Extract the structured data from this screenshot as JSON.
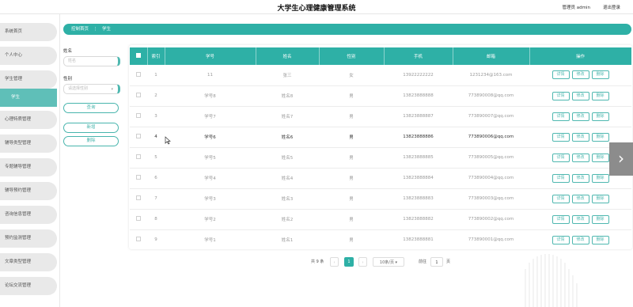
{
  "header": {
    "title": "大学生心理健康管理系统",
    "user": "管理员 admin",
    "logout": "退出登录"
  },
  "sidebar": {
    "items": [
      {
        "label": "系统首页"
      },
      {
        "label": "个人中心"
      },
      {
        "label": "学生管理"
      },
      {
        "label": "学生"
      },
      {
        "label": "心理特质管理"
      },
      {
        "label": "辅导类型管理"
      },
      {
        "label": "专题辅导管理"
      },
      {
        "label": "辅导预约管理"
      },
      {
        "label": "咨询信息管理"
      },
      {
        "label": "预约监测管理"
      },
      {
        "label": "文章类型管理"
      },
      {
        "label": "论坛交流管理"
      }
    ]
  },
  "breadcrumb": {
    "home": "控制首页",
    "sep": "⋮",
    "current": "学生"
  },
  "filter": {
    "name_label": "姓名",
    "name_placeholder": "姓名",
    "gender_label": "性别",
    "gender_placeholder": "请选择性别",
    "search_btn": "查询",
    "add_btn": "新增",
    "delete_btn": "删除"
  },
  "table": {
    "headers": [
      "索引",
      "学号",
      "姓名",
      "性别",
      "手机",
      "邮箱",
      "操作"
    ],
    "rows": [
      {
        "idx": "1",
        "id": "11",
        "name": "张三",
        "gender": "女",
        "phone": "13922222222",
        "email": "1231234@163.com"
      },
      {
        "idx": "2",
        "id": "学号8",
        "name": "姓名8",
        "gender": "男",
        "phone": "13823888888",
        "email": "773890008@qq.com"
      },
      {
        "idx": "3",
        "id": "学号7",
        "name": "姓名7",
        "gender": "男",
        "phone": "13823888887",
        "email": "773890007@qq.com"
      },
      {
        "idx": "4",
        "id": "学号6",
        "name": "姓名6",
        "gender": "男",
        "phone": "13823888886",
        "email": "773890006@qq.com"
      },
      {
        "idx": "5",
        "id": "学号5",
        "name": "姓名5",
        "gender": "男",
        "phone": "13823888885",
        "email": "773890005@qq.com"
      },
      {
        "idx": "6",
        "id": "学号4",
        "name": "姓名4",
        "gender": "男",
        "phone": "13823888884",
        "email": "773890004@qq.com"
      },
      {
        "idx": "7",
        "id": "学号3",
        "name": "姓名3",
        "gender": "男",
        "phone": "13823888883",
        "email": "773890003@qq.com"
      },
      {
        "idx": "8",
        "id": "学号2",
        "name": "姓名2",
        "gender": "男",
        "phone": "13823888882",
        "email": "773890002@qq.com"
      },
      {
        "idx": "9",
        "id": "学号1",
        "name": "姓名1",
        "gender": "男",
        "phone": "13823888881",
        "email": "773890001@qq.com"
      }
    ],
    "actions": {
      "detail": "详情",
      "edit": "修改",
      "delete": "删除"
    }
  },
  "pager": {
    "total": "共 9 条",
    "current_page": "1",
    "page_size": "10条/页",
    "goto_label": "前往",
    "goto_value": "1",
    "page_unit": "页"
  },
  "colors": {
    "accent": "#2eb0a6"
  },
  "icons": {
    "next": "chevron-right-icon",
    "cursor": "mouse-pointer-icon"
  }
}
